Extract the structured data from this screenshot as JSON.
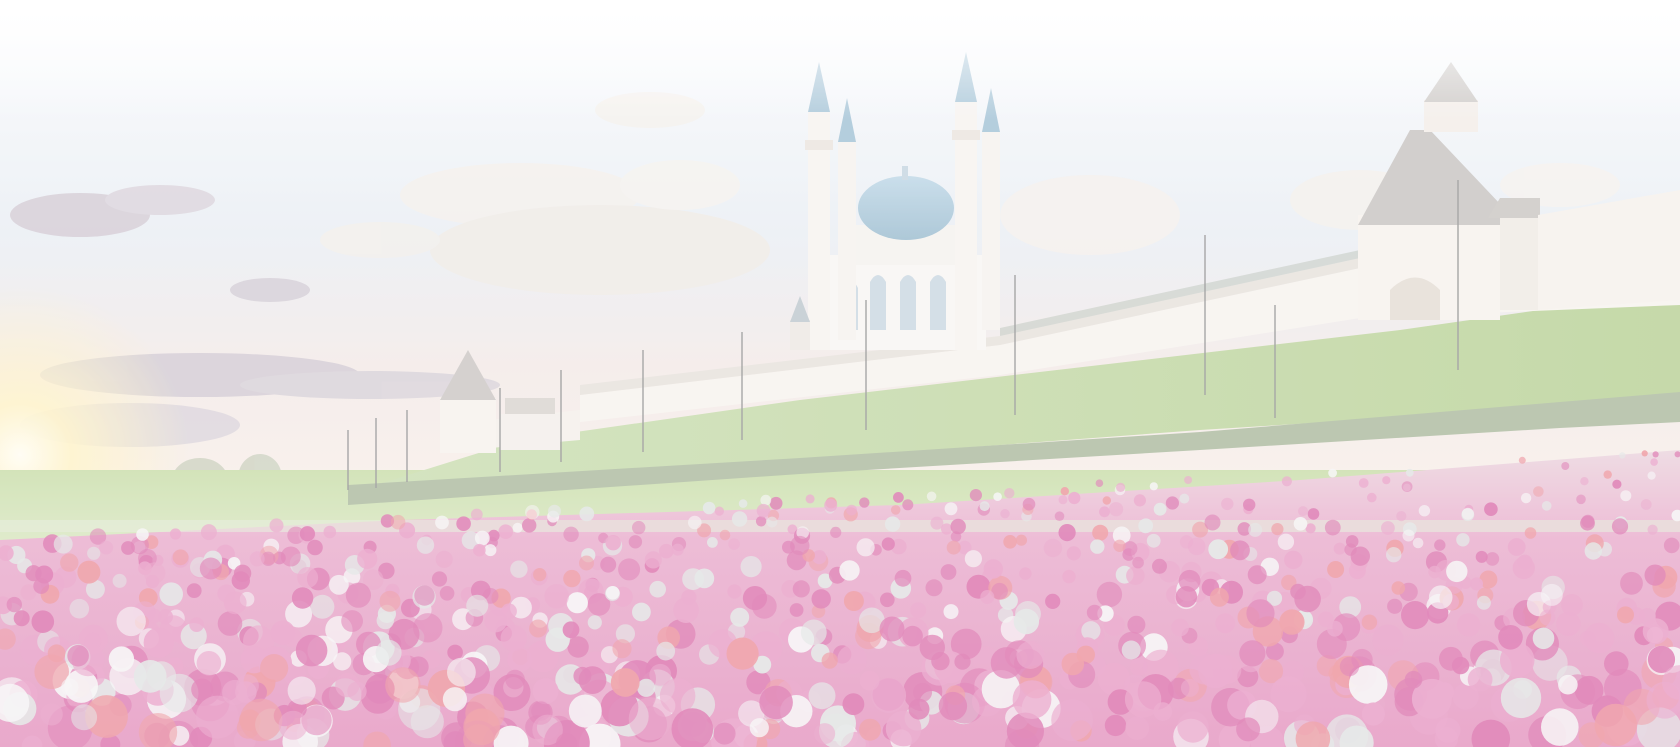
{
  "image": {
    "subject": "kremlin-panorama-with-mosque-and-flower-field",
    "palette": {
      "sky_top": "#ffffff",
      "sky_mid": "#e9eef4",
      "sky_low": "#f5e9e4",
      "sun_glow": "#fff3c8",
      "cloud": "#f0ede9",
      "cloud_dark": "#c9c1c9",
      "wall": "#f7f3ef",
      "wall_shadow": "#e8e1da",
      "roof": "#cfcbc7",
      "dome": "#a9c8da",
      "grass": "#cfe0b2",
      "grass_dark": "#b8d096",
      "hedge": "#a8b69c",
      "flower_pink": "#e79ac4",
      "flower_magenta": "#d96aa8",
      "flower_white": "#f5f3f4",
      "flower_silver": "#dfe3e2",
      "flower_red": "#ec8f98"
    }
  }
}
